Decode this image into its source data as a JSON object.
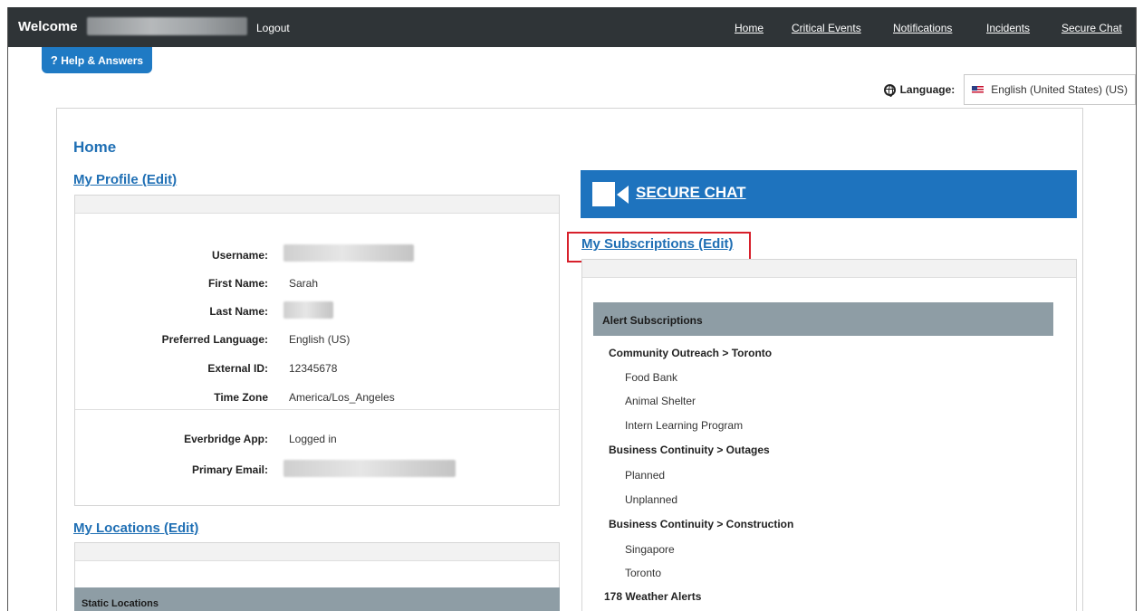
{
  "header": {
    "welcome": "Welcome",
    "logout": "Logout",
    "nav": [
      "Home",
      "Critical Events",
      "Notifications",
      "Incidents",
      "Secure Chat"
    ]
  },
  "help_button": {
    "icon": "?",
    "label": "Help & Answers"
  },
  "language": {
    "icon": "globe-icon",
    "label": "Language:",
    "flag": "us-flag-icon",
    "value": "English (United States) (US)"
  },
  "page": {
    "title": "Home"
  },
  "profile": {
    "title": "My Profile (Edit)",
    "fields": [
      {
        "label": "Username:",
        "value": ""
      },
      {
        "label": "First Name:",
        "value": "Sarah"
      },
      {
        "label": "Last Name:",
        "value": ""
      },
      {
        "label": "Preferred Language:",
        "value": "English (US)"
      },
      {
        "label": "External ID:",
        "value": "12345678"
      },
      {
        "label": "Time Zone",
        "value": "America/Los_Angeles"
      }
    ],
    "app_fields": [
      {
        "label": "Everbridge App:",
        "value": "Logged in"
      },
      {
        "label": "Primary Email:",
        "value": ""
      }
    ]
  },
  "locations": {
    "title": "My Locations (Edit)",
    "static_header": "Static Locations"
  },
  "secure_chat": {
    "icon": "video-camera-icon",
    "label": "SECURE CHAT"
  },
  "subscriptions": {
    "title": "My Subscriptions (Edit)",
    "header": "Alert Subscriptions",
    "groups": [
      {
        "name": "Community Outreach > Toronto",
        "items": [
          "Food Bank",
          "Animal Shelter",
          "Intern Learning Program"
        ]
      },
      {
        "name": "Business Continuity > Outages",
        "items": [
          "Planned",
          "Unplanned"
        ]
      },
      {
        "name": "Business Continuity > Construction",
        "items": [
          "Singapore",
          "Toronto"
        ]
      }
    ],
    "weather": "178 Weather Alerts"
  },
  "colors": {
    "topbar": "#2f3437",
    "link": "#1f6fb4",
    "accent": "#1e73be",
    "highlight": "#d7202b",
    "table_header": "#8e9da5"
  }
}
